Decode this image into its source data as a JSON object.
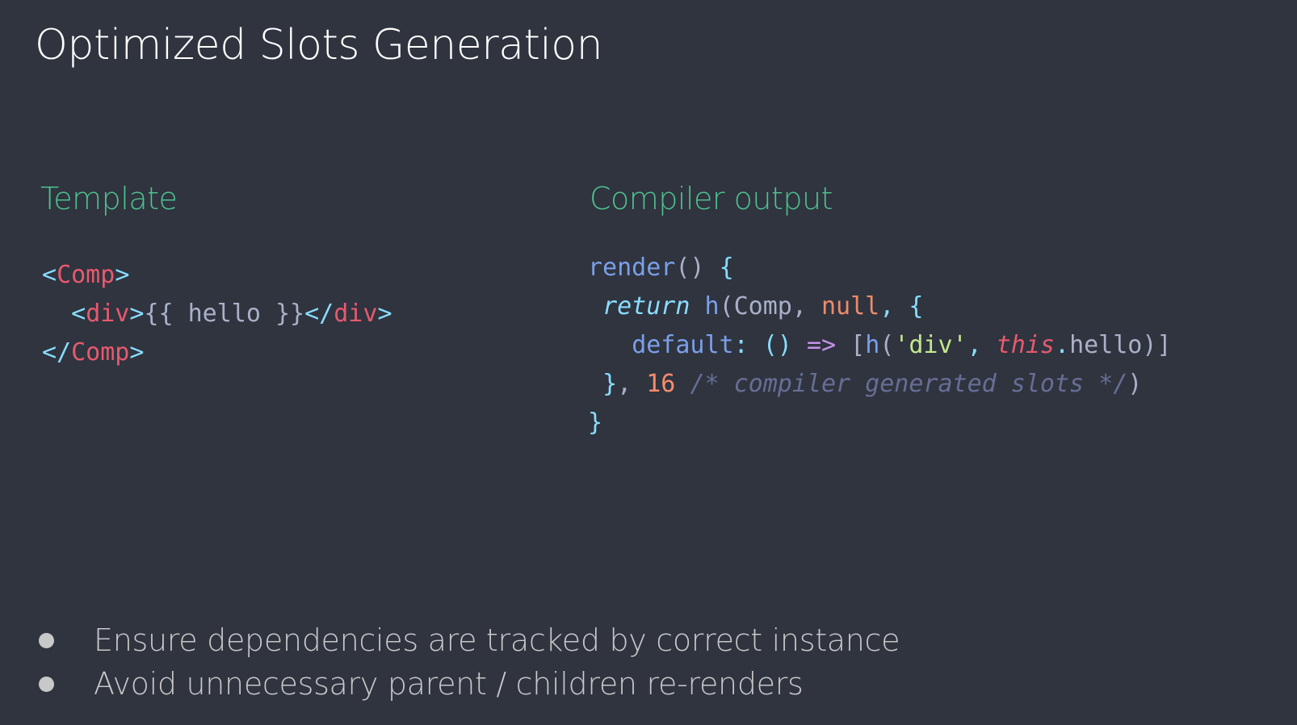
{
  "slide": {
    "title": "Optimized Slots Generation",
    "template_heading": "Template",
    "output_heading": "Compiler output",
    "template_code": [
      [
        {
          "t": "<",
          "c": "punct"
        },
        {
          "t": "Comp",
          "c": "tag"
        },
        {
          "t": ">",
          "c": "punct"
        }
      ],
      [
        {
          "t": "  ",
          "c": "plain"
        },
        {
          "t": "<",
          "c": "punct"
        },
        {
          "t": "div",
          "c": "tag"
        },
        {
          "t": ">",
          "c": "punct"
        },
        {
          "t": "{{ hello }}",
          "c": "text"
        },
        {
          "t": "</",
          "c": "punct"
        },
        {
          "t": "div",
          "c": "tag"
        },
        {
          "t": ">",
          "c": "punct"
        }
      ],
      [
        {
          "t": "</",
          "c": "punct"
        },
        {
          "t": "Comp",
          "c": "tag"
        },
        {
          "t": ">",
          "c": "punct"
        }
      ]
    ],
    "output_code": [
      [
        {
          "t": "render",
          "c": "fn"
        },
        {
          "t": "() ",
          "c": "plain"
        },
        {
          "t": "{",
          "c": "punct"
        }
      ],
      [
        {
          "t": " ",
          "c": "plain"
        },
        {
          "t": "return",
          "c": "kw"
        },
        {
          "t": " ",
          "c": "plain"
        },
        {
          "t": "h",
          "c": "fn"
        },
        {
          "t": "(Comp, ",
          "c": "plain"
        },
        {
          "t": "null",
          "c": "null"
        },
        {
          "t": ", ",
          "c": "punct"
        },
        {
          "t": "{",
          "c": "punct"
        }
      ],
      [
        {
          "t": "   ",
          "c": "plain"
        },
        {
          "t": "default",
          "c": "prop"
        },
        {
          "t": ": ",
          "c": "punct"
        },
        {
          "t": "() ",
          "c": "punct"
        },
        {
          "t": "=>",
          "c": "arrow"
        },
        {
          "t": " [",
          "c": "plain"
        },
        {
          "t": "h",
          "c": "fn"
        },
        {
          "t": "(",
          "c": "plain"
        },
        {
          "t": "'div'",
          "c": "str"
        },
        {
          "t": ", ",
          "c": "punct"
        },
        {
          "t": "this",
          "c": "this"
        },
        {
          "t": ".",
          "c": "punct"
        },
        {
          "t": "hello)]",
          "c": "plain"
        }
      ],
      [
        {
          "t": " ",
          "c": "plain"
        },
        {
          "t": "}",
          "c": "punct"
        },
        {
          "t": ", ",
          "c": "plain"
        },
        {
          "t": "16",
          "c": "num"
        },
        {
          "t": " ",
          "c": "plain"
        },
        {
          "t": "/* compiler generated slots */",
          "c": "comment"
        },
        {
          "t": ")",
          "c": "plain"
        }
      ],
      [
        {
          "t": "}",
          "c": "punct"
        }
      ]
    ],
    "bullets": [
      "Ensure dependencies are tracked by correct instance",
      "Avoid unnecessary parent / children re-renders"
    ]
  },
  "colors": {
    "background": "#2f343f",
    "heading_accent": "#4fc08d",
    "title": "#ffffff",
    "bullet_text": "#c8c8c8"
  }
}
